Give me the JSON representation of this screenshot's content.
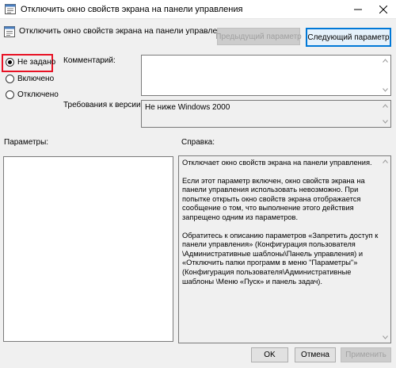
{
  "window": {
    "title": "Отключить окно свойств экрана на панели управления",
    "icon": "policy-icon"
  },
  "header": {
    "title": "Отключить окно свойств экрана на панели управления",
    "icon": "policy-icon",
    "prev_label": "Предыдущий параметр",
    "next_label": "Следующий параметр"
  },
  "state": {
    "options": [
      {
        "label": "Не задано",
        "selected": true
      },
      {
        "label": "Включено",
        "selected": false
      },
      {
        "label": "Отключено",
        "selected": false
      }
    ]
  },
  "comment": {
    "label": "Комментарий:",
    "value": ""
  },
  "supported": {
    "label": "Требования к версии:",
    "value": "Не ниже Windows 2000"
  },
  "params": {
    "label": "Параметры:"
  },
  "help": {
    "label": "Справка:",
    "paragraphs": [
      "Отключает окно свойств экрана на панели управления.",
      "Если этот параметр включен, окно свойств экрана на панели управления использовать невозможно. При попытке открыть окно свойств экрана отображается сообщение о том, что выполнение этого действия запрещено одним из параметров.",
      "Обратитесь к описанию параметров «Запретить доступ к панели управления» (Конфигурация пользователя \\Административные шаблоны\\Панель управления) и «Отключить папки программ в меню \"Параметры\"» (Конфигурация пользователя\\Административные шаблоны \\Меню «Пуск» и панель задач)."
    ]
  },
  "buttons": {
    "ok": "OK",
    "cancel": "Отмена",
    "apply": "Применить"
  },
  "colors": {
    "accent": "#0078d7",
    "highlight": "#e81123"
  }
}
